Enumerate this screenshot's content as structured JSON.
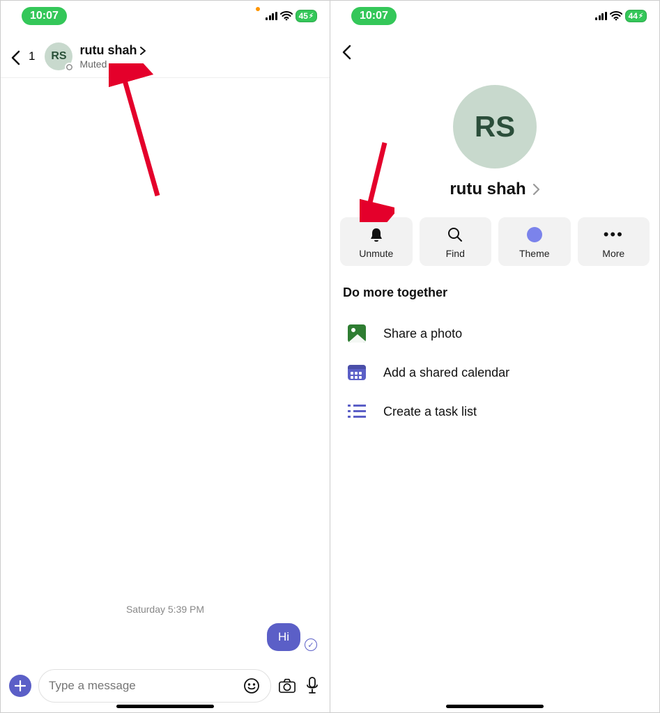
{
  "left": {
    "status": {
      "time": "10:07",
      "battery": "45",
      "charging": true
    },
    "header": {
      "unread": "1",
      "avatar_initials": "RS",
      "name": "rutu shah",
      "subtitle": "Muted"
    },
    "chat": {
      "timestamp": "Saturday 5:39 PM",
      "message_text": "Hi"
    },
    "compose": {
      "placeholder": "Type a message"
    }
  },
  "right": {
    "status": {
      "time": "10:07",
      "battery": "44",
      "charging": true
    },
    "profile": {
      "avatar_initials": "RS",
      "name": "rutu shah"
    },
    "actions": {
      "unmute": "Unmute",
      "find": "Find",
      "theme": "Theme",
      "more": "More"
    },
    "section_title": "Do more together",
    "options": {
      "photo": "Share a photo",
      "calendar": "Add a shared calendar",
      "tasks": "Create a task list"
    }
  }
}
